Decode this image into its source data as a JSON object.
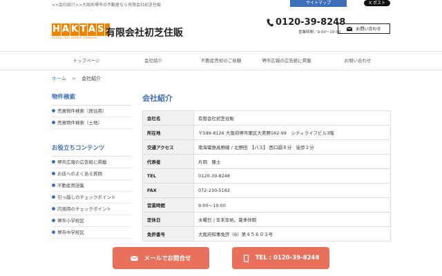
{
  "topbar": {
    "tagline": "<<会社紹介>>大阪府堺市の不動産なら有限会社初芝住販",
    "sitemap_label": "サイトマップ",
    "post_label": "X ポスト"
  },
  "header": {
    "logo_letters": [
      "H",
      "A",
      "K",
      "T",
      "A",
      "S",
      "."
    ],
    "logo_sub": "osaka real estate network",
    "company_name": "有限会社初芝住販",
    "phone": "0120-39-8248",
    "hours": "営業時間／9:00～19:00",
    "contact_label": "お問い合わせ"
  },
  "nav": {
    "items": [
      "トップページ",
      "会社紹介",
      "不動産売却のご依頼",
      "堺市広報の広告紙に掲載",
      "お問い合わせ"
    ]
  },
  "breadcrumb": {
    "home": "ホーム",
    "separator": ">",
    "current": "会社紹介"
  },
  "sidebar": {
    "section1_title": "物件検索",
    "section1_items": [
      "売買物件検索（居住用）",
      "売買物件検索（土地）"
    ],
    "section2_title": "お役立ちコンテンツ",
    "section2_items": [
      "堺市広報の広告紙に掲載",
      "お店へのよくある質問",
      "不動産用語集",
      "引っ越しのチェックポイント",
      "内見時のチェックポイント",
      "堺市小学校区",
      "堺市中学校区"
    ]
  },
  "main": {
    "title": "会社紹介",
    "rows": [
      {
        "label": "会社名",
        "value": "有限会社初芝住販"
      },
      {
        "label": "所在地",
        "value": "〒599-8126 大阪府堺市東区大美野162-99　シティライフビル3階"
      },
      {
        "label": "交通アクセス",
        "value": "南海電鉄高野線 / 北野田　【バス】 西口園８分　徒歩２分"
      },
      {
        "label": "代表者",
        "value": "片岡　隆士"
      },
      {
        "label": "TEL",
        "value": "0120-39-8248"
      },
      {
        "label": "FAX",
        "value": "072-230-5182"
      },
      {
        "label": "営業時間",
        "value": "9:00～19:00"
      },
      {
        "label": "定休日",
        "value": "水曜日 / 年末年始、夏季休暇"
      },
      {
        "label": "免許番号",
        "value": "大阪府知事免許（6）第４５６０３号"
      }
    ]
  },
  "bottom": {
    "mail_cta": "メールでお問合せ",
    "tel_cta": "TEL : 0120-39-8248"
  },
  "colors": {
    "accent_blue": "#3d6fb7",
    "logo_orange": "#f08300",
    "cta_red": "#e8715c"
  }
}
